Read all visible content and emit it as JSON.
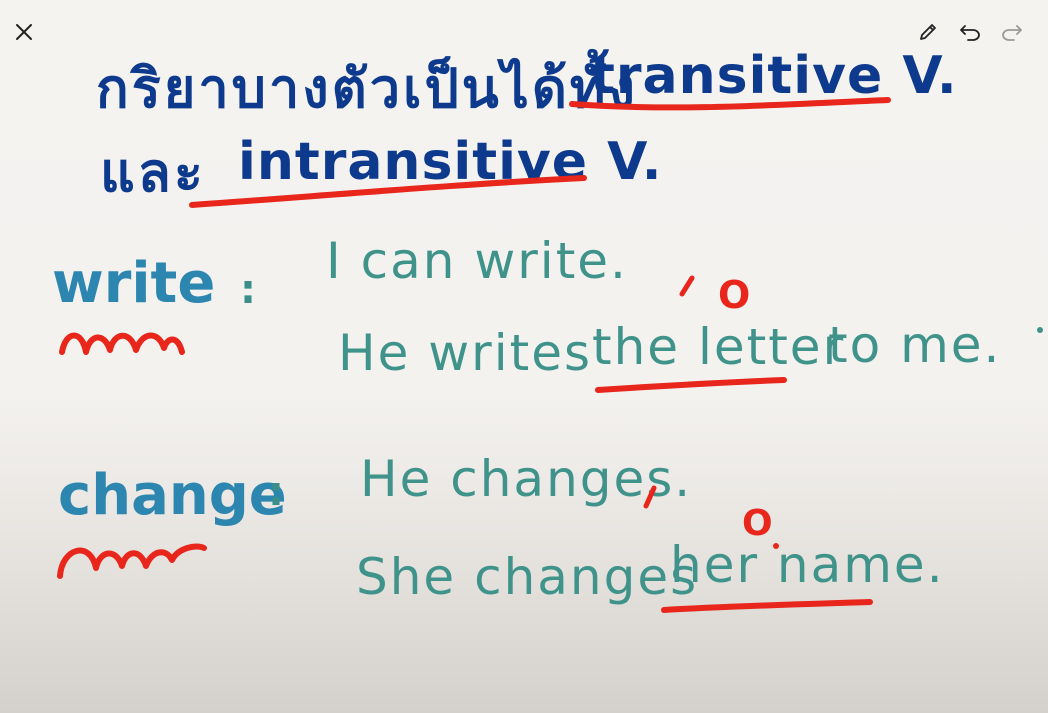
{
  "toolbar": {
    "close_icon": "close-icon",
    "pen_icon": "pencil-icon",
    "undo_icon": "undo-icon",
    "redo_icon": "redo-icon"
  },
  "heading": {
    "line1_thai": "กริยาบางตัวเป็นได้ทั้ง",
    "line1_term": "transitive V.",
    "line2_thai": "และ",
    "line2_term": "intransitive V."
  },
  "examples": [
    {
      "word": "write",
      "colon": ":",
      "sentence1": "I can write.",
      "sentence2_prefix": "He writes",
      "sentence2_object": "the letter",
      "sentence2_suffix": "to me."
    },
    {
      "word": "change",
      "colon": ":",
      "sentence1": "He changes.",
      "sentence2_prefix": "She changes",
      "sentence2_object": "her name."
    }
  ],
  "annotations": {
    "object_marker_1": "O",
    "object_marker_2": "O"
  },
  "colors": {
    "heading_ink": "#0d3a8c",
    "word_ink": "#2d86b0",
    "sentence_ink": "#3f938a",
    "marker_red": "#e8261c"
  }
}
